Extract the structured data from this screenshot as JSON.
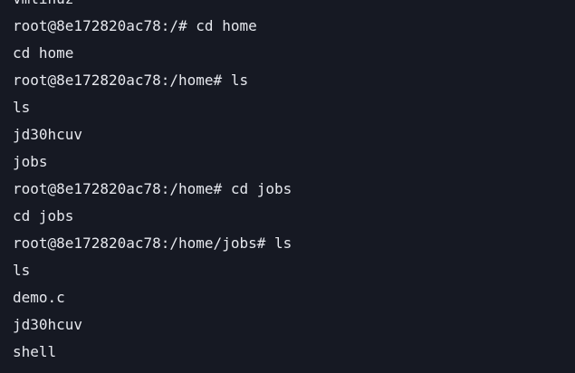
{
  "terminal": {
    "lines": [
      "vmlinuz",
      "root@8e172820ac78:/# cd home",
      "cd home",
      "root@8e172820ac78:/home# ls",
      "ls",
      "jd30hcuv",
      "jobs",
      "root@8e172820ac78:/home# cd jobs",
      "cd jobs",
      "root@8e172820ac78:/home/jobs# ls",
      "ls",
      "demo.c",
      "jd30hcuv",
      "shell"
    ]
  }
}
